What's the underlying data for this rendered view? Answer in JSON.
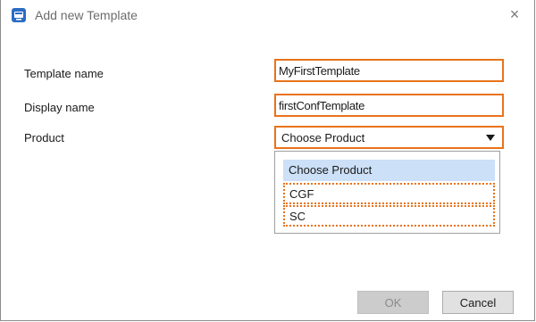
{
  "window": {
    "title": "Add new Template",
    "close_glyph": "×",
    "app_icon": "app-window-icon"
  },
  "form": {
    "template_name_label": "Template name",
    "template_name_value": "MyFirstTemplate",
    "display_name_label": "Display name",
    "display_name_value": "firstConfTemplate",
    "product_label": "Product",
    "product_selected": "Choose Product"
  },
  "dropdown": {
    "options": [
      "Choose Product",
      "CGF",
      "SC"
    ]
  },
  "buttons": {
    "ok_label": "OK",
    "cancel_label": "Cancel"
  },
  "colors": {
    "highlight_border": "#e8731a",
    "selected_option_bg": "#cce0f7",
    "app_icon": "#2b6cc4"
  }
}
